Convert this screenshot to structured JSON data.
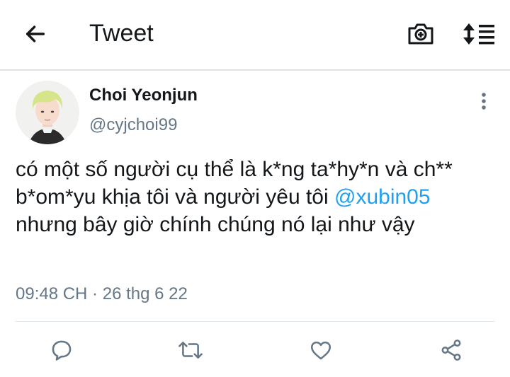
{
  "header": {
    "title": "Tweet",
    "back_icon": "arrow-left-icon",
    "camera_icon": "camera-plus-icon",
    "sort_icon": "sort-list-icon"
  },
  "tweet": {
    "author_name": "Choi Yeonjun",
    "author_handle": "@cyjchoi99",
    "text_before": "có một số người cụ thể là k*ng ta*hy*n và ch** b*om*yu khịa tôi và người yêu tôi ",
    "mention": "@xubin05",
    "text_after": " nhưng bây giờ chính chúng nó lại như vậy",
    "timestamp": "09:48 CH · 26 thg 6 22"
  },
  "actions": [
    "reply-icon",
    "retweet-icon",
    "like-icon",
    "share-icon"
  ],
  "colors": {
    "accent": "#1da1f2",
    "icon": "#657786",
    "text": "#14171a"
  }
}
